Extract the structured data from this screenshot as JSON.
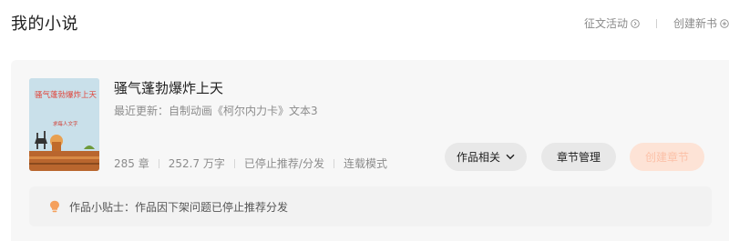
{
  "header": {
    "title": "我的小说",
    "contest_label": "征文活动",
    "create_book_label": "创建新书"
  },
  "book": {
    "title": "骚气蓬勃爆炸上天",
    "recent_update": "最近更新：自制动画《柯尔内力卡》文本3",
    "cover": {
      "title": "骚气蓬勃爆炸上天",
      "subtitle": "求每人文字"
    },
    "stats": {
      "chapters": "285 章",
      "words": "252.7 万字",
      "recommend_status": "已停止推荐/分发",
      "mode": "连载模式"
    }
  },
  "actions": {
    "related_label": "作品相关",
    "chapter_manage_label": "章节管理",
    "create_chapter_label": "创建章节"
  },
  "tip": {
    "text": "作品小贴士：作品因下架问题已停止推荐分发"
  },
  "colors": {
    "accent": "#fc6a3c",
    "create_button_bg": "#fde3d6",
    "tip_icon": "#f5a05c"
  }
}
